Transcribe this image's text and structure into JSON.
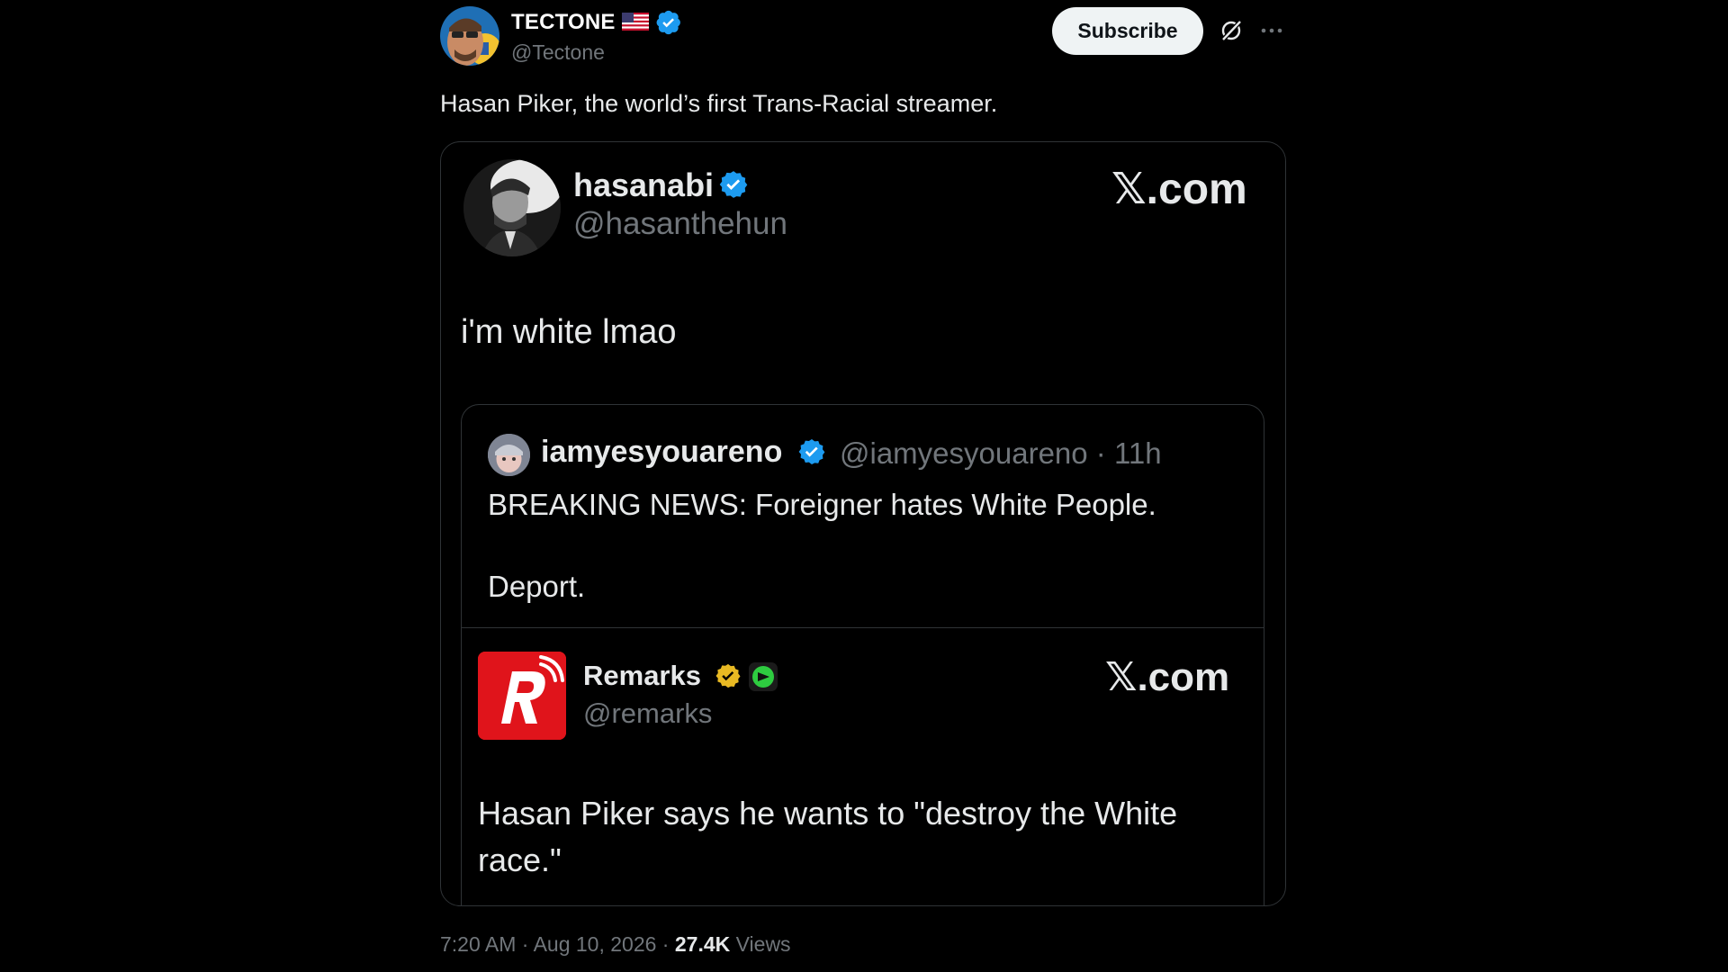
{
  "post": {
    "author": {
      "display_name": "TECTONE",
      "handle": "@Tectone",
      "flag_icon": "us-flag-icon",
      "verified_color": "#1d9bf0"
    },
    "subscribe_label": "Subscribe",
    "text": "Hasan Piker, the world’s first Trans-Racial streamer.",
    "meta": {
      "time": "7:20 AM",
      "sep1": " · ",
      "date": "Aug 10, 2026",
      "sep2": " · ",
      "views_count": "27.4K",
      "views_label": "Views"
    }
  },
  "media": {
    "quoted": {
      "display_name": "hasanabi",
      "handle": "@hasanthehun",
      "site_label": "𝕏.com",
      "text": "i'm white lmao"
    },
    "inner": {
      "display_name": "iamyesyouareno",
      "handle_time": "@iamyesyouareno · 11h",
      "text_line1": "BREAKING NEWS: Foreigner hates White People.",
      "text_line2": "Deport."
    },
    "remarks": {
      "display_name": "Remarks",
      "handle": "@remarks",
      "site_label": "𝕏.com",
      "text": "Hasan Piker says he wants to \"destroy the White race.\"",
      "brand_color": "#e0141b",
      "gold_badge_color": "#e8b923",
      "green_badge_color": "#2ecc40"
    }
  }
}
